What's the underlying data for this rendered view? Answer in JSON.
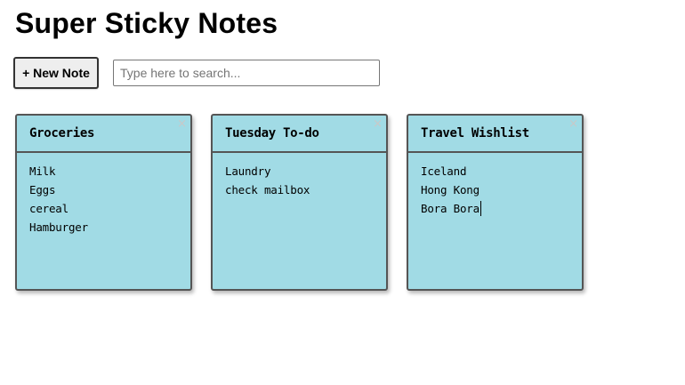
{
  "app": {
    "title": "Super Sticky Notes"
  },
  "toolbar": {
    "new_note_label": "+ New Note",
    "search_placeholder": "Type here to search...",
    "search_value": ""
  },
  "notes": [
    {
      "title": "Groceries",
      "close_glyph": "×",
      "lines": [
        "Milk",
        "Eggs",
        "cereal",
        "Hamburger"
      ]
    },
    {
      "title": "Tuesday To-do",
      "close_glyph": "×",
      "lines": [
        "Laundry",
        "check mailbox"
      ]
    },
    {
      "title": "Travel Wishlist",
      "close_glyph": "×",
      "lines": [
        "Iceland",
        "Hong Kong",
        "Bora Bora"
      ]
    }
  ],
  "colors": {
    "note_background": "#a1dbe5",
    "note_border": "#555555",
    "button_background": "#eeeeee"
  },
  "icons": {
    "close": "close-icon",
    "text_caret": "text-caret"
  }
}
